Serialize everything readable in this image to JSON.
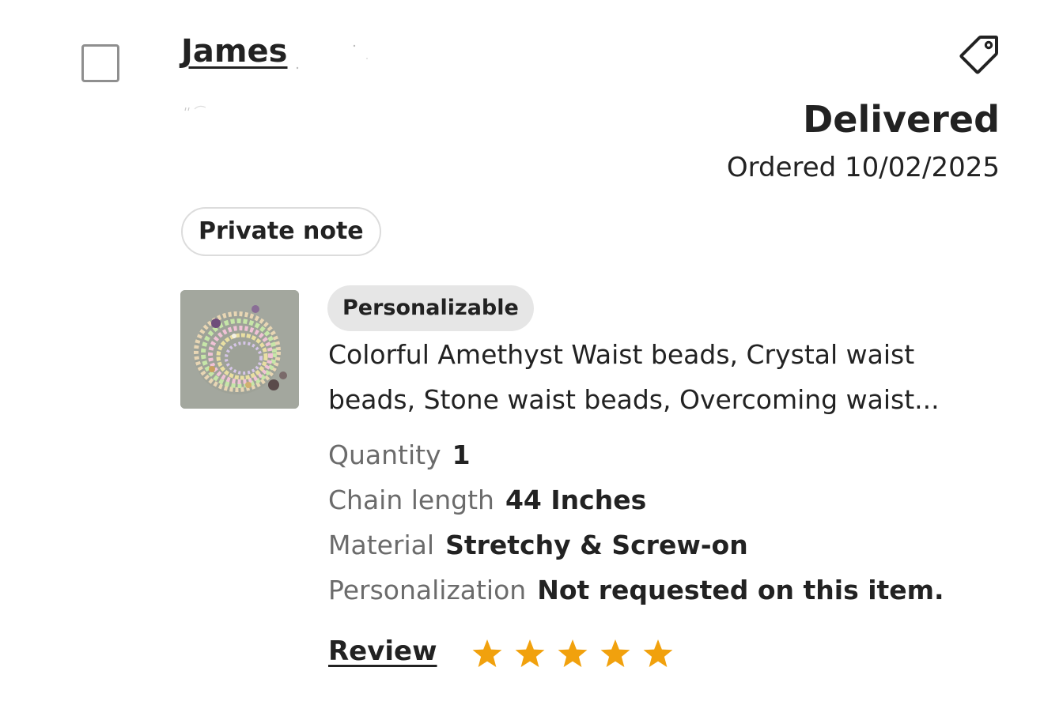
{
  "order": {
    "buyer_name": "James",
    "status": "Delivered",
    "ordered_label": "Ordered 10/02/2025",
    "private_note_label": "Private note"
  },
  "item": {
    "badge": "Personalizable",
    "title_line1": "Colorful Amethyst Waist beads, Crystal waist",
    "title_line2": "beads, Stone waist beads, Overcoming waist...",
    "image_icon": "waist-beads-product-photo",
    "attributes": [
      {
        "label": "Quantity",
        "value": "1"
      },
      {
        "label": "Chain length",
        "value": "44 Inches"
      },
      {
        "label": "Material",
        "value": "Stretchy & Screw-on"
      },
      {
        "label": "Personalization",
        "value": "Not requested on this item."
      }
    ]
  },
  "review": {
    "label": "Review",
    "rating": 5,
    "max_rating": 5,
    "star_color": "#f1a10d"
  },
  "icons": {
    "tag": "tag-icon",
    "checkbox": "checkbox"
  }
}
